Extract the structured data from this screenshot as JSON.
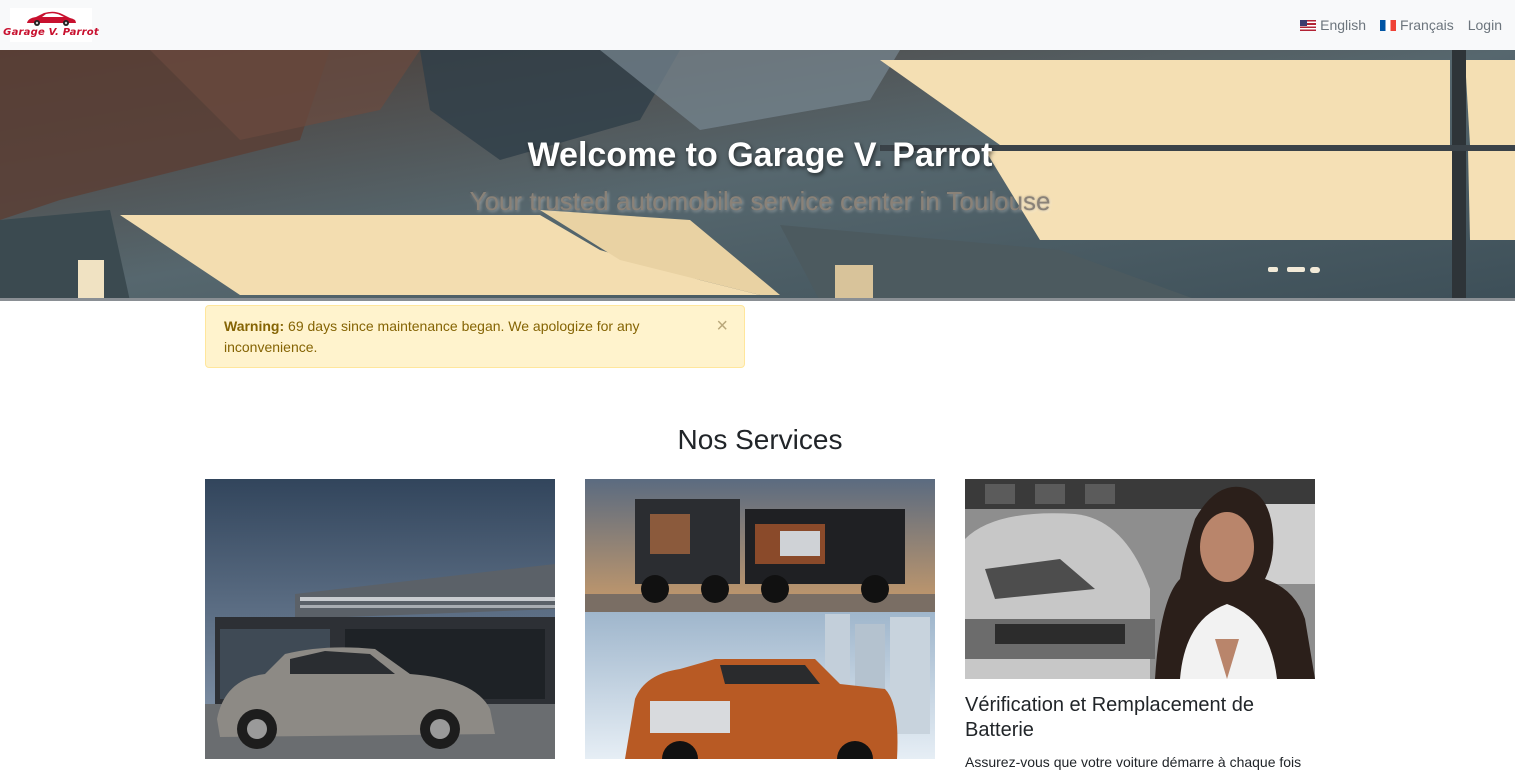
{
  "navbar": {
    "brand_text": "Garage V. Parrot",
    "links": [
      {
        "label": "English",
        "icon": "us-flag-icon"
      },
      {
        "label": "Français",
        "icon": "fr-flag-icon"
      },
      {
        "label": "Login"
      }
    ]
  },
  "hero": {
    "title": "Welcome to Garage V. Parrot",
    "subtitle": "Your trusted automobile service center in Toulouse"
  },
  "alert": {
    "label": "Warning:",
    "message": " 69 days since maintenance began. We apologize for any inconvenience.",
    "close_symbol": "×"
  },
  "services": {
    "heading": "Nos Services",
    "cards": [
      {
        "title": "",
        "text": ""
      },
      {
        "title": "",
        "text": ""
      },
      {
        "title": "Vérification et Remplacement de Batterie",
        "text": "Assurez-vous que votre voiture démarre à chaque fois"
      }
    ]
  },
  "colors": {
    "brand_red": "#c8102e",
    "navbar_bg": "#f8f9fa",
    "alert_bg": "#fff3cd",
    "alert_text": "#856404"
  }
}
